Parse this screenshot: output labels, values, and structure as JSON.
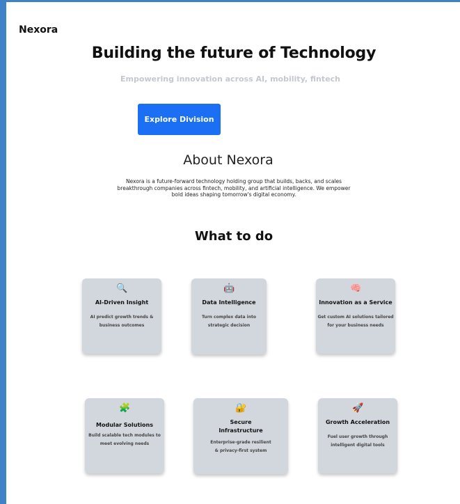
{
  "brand": "Nexora",
  "hero": {
    "title": "Building the future of Technology",
    "subtitle": "Empowering innovation across AI, mobility, fintech",
    "cta_label": "Explore Division"
  },
  "about": {
    "title": "About Nexora",
    "text": "Nexora is a future-forward technology holding group that builds, backs, and scales breakthrough companies across fintech, mobility, and artificial intelligence. We empower bold ideas shaping tomorrow's digital economy."
  },
  "services": {
    "title": "What to do",
    "cards": [
      {
        "icon": "magnifying-glass-icon",
        "glyph": "🔍",
        "title": "AI-Driven Insight",
        "desc": "AI predict growth trends & business outcomes"
      },
      {
        "icon": "robot-icon",
        "glyph": "🤖",
        "title": "Data Intelligence",
        "desc": "Turn complex data into strategic decision"
      },
      {
        "icon": "brain-icon",
        "glyph": "🧠",
        "title": "Innovation as a Service",
        "desc": "Get custom AI solutions tailored for your business needs"
      },
      {
        "icon": "puzzle-piece-icon",
        "glyph": "🧩",
        "title": "Modular Solutions",
        "desc": "Build scalable tech modules to meet evolving needs"
      },
      {
        "icon": "lock-key-icon",
        "glyph": "🔐",
        "title": "Secure Infrastructure",
        "desc": "Enterprise-grade resilient & privacy-first system"
      },
      {
        "icon": "rocket-icon",
        "glyph": "🚀",
        "title": "Growth Acceleration",
        "desc": "Fuel user growth through intelligent digital tools"
      }
    ]
  },
  "colors": {
    "accent": "#1a6ff5",
    "card_bg": "#d2d7dd",
    "frame": "#3f82c7",
    "subtitle": "#c3c8cf"
  }
}
